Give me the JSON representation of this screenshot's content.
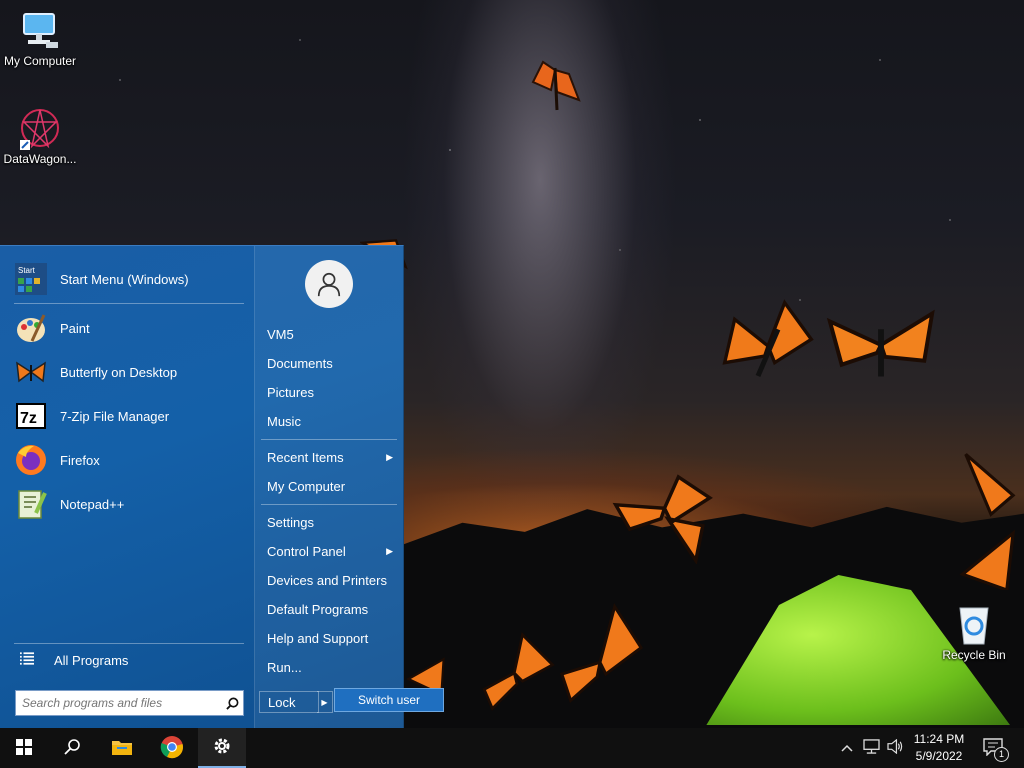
{
  "desktop": {
    "icons": [
      {
        "label": "My Computer",
        "icon": "computer-icon"
      },
      {
        "label": "DataWagon...",
        "icon": "datawagon-icon"
      },
      {
        "label": "Recycle Bin",
        "icon": "recycle-bin-icon"
      }
    ]
  },
  "start_menu": {
    "pinned": [
      {
        "label": "Start Menu (Windows)",
        "icon": "start-menu-icon"
      }
    ],
    "programs": [
      {
        "label": "Paint",
        "icon": "paint-icon"
      },
      {
        "label": "Butterfly on Desktop",
        "icon": "butterfly-icon"
      },
      {
        "label": "7-Zip File Manager",
        "icon": "7zip-icon"
      },
      {
        "label": "Firefox",
        "icon": "firefox-icon"
      },
      {
        "label": "Notepad++",
        "icon": "notepadpp-icon"
      }
    ],
    "all_programs": "All Programs",
    "search_placeholder": "Search programs and files",
    "user": {
      "icon": "user-avatar-icon"
    },
    "right_items": [
      {
        "label": "VM5",
        "submenu": false
      },
      {
        "label": "Documents",
        "submenu": false
      },
      {
        "label": "Pictures",
        "submenu": false
      },
      {
        "label": "Music",
        "submenu": false
      },
      {
        "label": "Recent Items",
        "submenu": true
      },
      {
        "label": "My Computer",
        "submenu": false
      },
      {
        "label": "Settings",
        "submenu": false
      },
      {
        "label": "Control Panel",
        "submenu": true
      },
      {
        "label": "Devices and Printers",
        "submenu": false
      },
      {
        "label": "Default Programs",
        "submenu": false
      },
      {
        "label": "Help and Support",
        "submenu": false
      },
      {
        "label": "Run...",
        "submenu": false
      }
    ],
    "lock_label": "Lock",
    "switch_user_label": "Switch user"
  },
  "taskbar": {
    "buttons": [
      "windows-start-icon",
      "search-icon",
      "file-explorer-icon",
      "chrome-icon",
      "settings-gear-icon"
    ],
    "active": "settings-gear-icon",
    "clock_time": "11:24 PM",
    "clock_date": "5/9/2022",
    "notification_count": "1"
  },
  "colors": {
    "start_menu_bg": "#1460a8",
    "taskbar_bg": "#101010",
    "accent": "#7fb0e6"
  }
}
